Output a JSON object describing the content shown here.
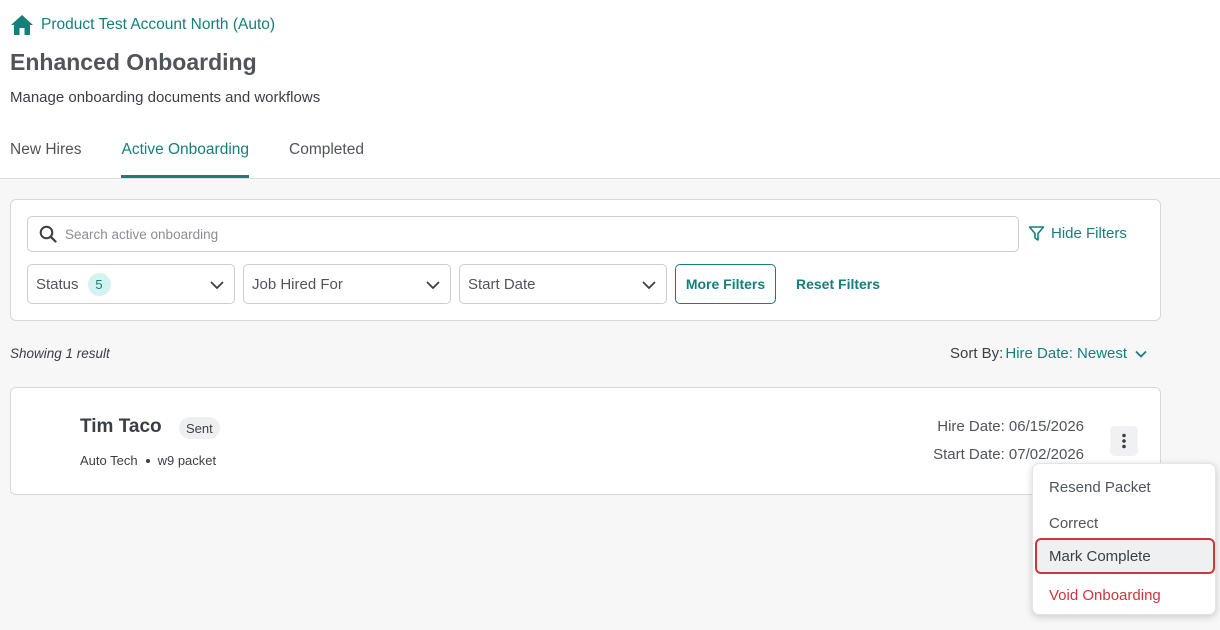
{
  "breadcrumb": {
    "account": "Product Test Account North (Auto)"
  },
  "header": {
    "title": "Enhanced Onboarding",
    "subtitle": "Manage onboarding documents and workflows"
  },
  "tabs": [
    {
      "label": "New Hires",
      "active": false
    },
    {
      "label": "Active Onboarding",
      "active": true
    },
    {
      "label": "Completed",
      "active": false
    }
  ],
  "filters": {
    "search_placeholder": "Search active onboarding",
    "hide_filters_label": "Hide Filters",
    "status_label": "Status",
    "status_count": "5",
    "job_label": "Job Hired For",
    "start_date_label": "Start Date",
    "more_filters_label": "More Filters",
    "reset_filters_label": "Reset Filters"
  },
  "results": {
    "count_text": "Showing 1 result",
    "sort_label": "Sort By:",
    "sort_value": "Hire Date: Newest"
  },
  "card": {
    "name": "Tim Taco",
    "status": "Sent",
    "job": "Auto Tech",
    "packet": "w9 packet",
    "hire_date": "Hire Date: 06/15/2026",
    "start_date": "Start Date: 07/02/2026"
  },
  "menu": {
    "items": [
      {
        "label": "Resend Packet"
      },
      {
        "label": "Correct"
      },
      {
        "label": "Mark Complete",
        "highlighted": true
      },
      {
        "label": "Void Onboarding",
        "danger": true
      }
    ]
  },
  "colors": {
    "accent": "#157f7a",
    "danger": "#d0343c",
    "badge_bg": "#d4f2ef"
  },
  "icons": {
    "home": "home-icon",
    "search": "search-icon",
    "filter": "filter-icon",
    "chevron": "chevron-down-icon",
    "kebab": "kebab-menu-icon"
  }
}
